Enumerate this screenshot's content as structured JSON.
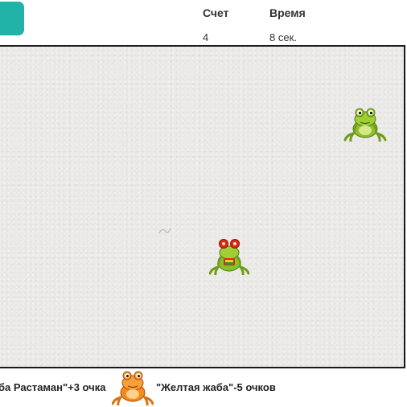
{
  "stats": {
    "score_label": "Счет",
    "score_value": "4",
    "time_label": "Время",
    "time_value": "8 сек."
  },
  "legend": {
    "rastaman_text": "ба Растаман\"+3 очка",
    "yellow_text": "\"Желтая жаба\"-5 очков"
  },
  "frogs": [
    {
      "type": "green-frog",
      "color": "#8cbf2a"
    },
    {
      "type": "rastaman-frog",
      "color": "#8cbf2a",
      "accent": "#e0261b"
    }
  ],
  "legend_icon": {
    "type": "yellow-frog",
    "color": "#f28a1c"
  },
  "colors": {
    "accent": "#21b3a8",
    "field_border": "#1a1a1a"
  }
}
